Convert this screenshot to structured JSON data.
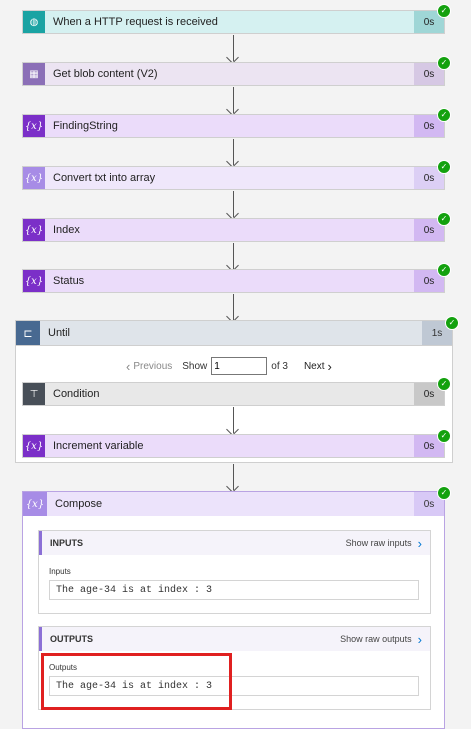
{
  "steps": [
    {
      "title": "When a HTTP request is received",
      "duration": "0s"
    },
    {
      "title": "Get blob content (V2)",
      "duration": "0s"
    },
    {
      "title": "FindingString",
      "duration": "0s"
    },
    {
      "title": "Convert txt into array",
      "duration": "0s"
    },
    {
      "title": "Index",
      "duration": "0s"
    },
    {
      "title": "Status",
      "duration": "0s"
    }
  ],
  "until": {
    "title": "Until",
    "duration": "1s",
    "pager": {
      "previous": "Previous",
      "show": "Show",
      "value": "1",
      "of": "of 3",
      "next": "Next"
    },
    "inner": [
      {
        "title": "Condition",
        "duration": "0s"
      },
      {
        "title": "Increment variable",
        "duration": "0s"
      }
    ]
  },
  "compose": {
    "title": "Compose",
    "duration": "0s",
    "inputs": {
      "header": "INPUTS",
      "raw_link": "Show raw inputs",
      "label": "Inputs",
      "value": "The age-34 is at index : 3"
    },
    "outputs": {
      "header": "OUTPUTS",
      "raw_link": "Show raw outputs",
      "label": "Outputs",
      "value": "The age-34 is at index : 3"
    }
  },
  "colors": {
    "success": "#13a10e",
    "variable": "#7b2fc8",
    "http": "#1aa3a3",
    "highlight": "#e02020"
  },
  "icons": {
    "http": "globe-icon",
    "blob": "blob-icon",
    "variable": "variable-icon",
    "until": "loop-icon",
    "condition": "condition-icon",
    "check": "check-icon"
  }
}
